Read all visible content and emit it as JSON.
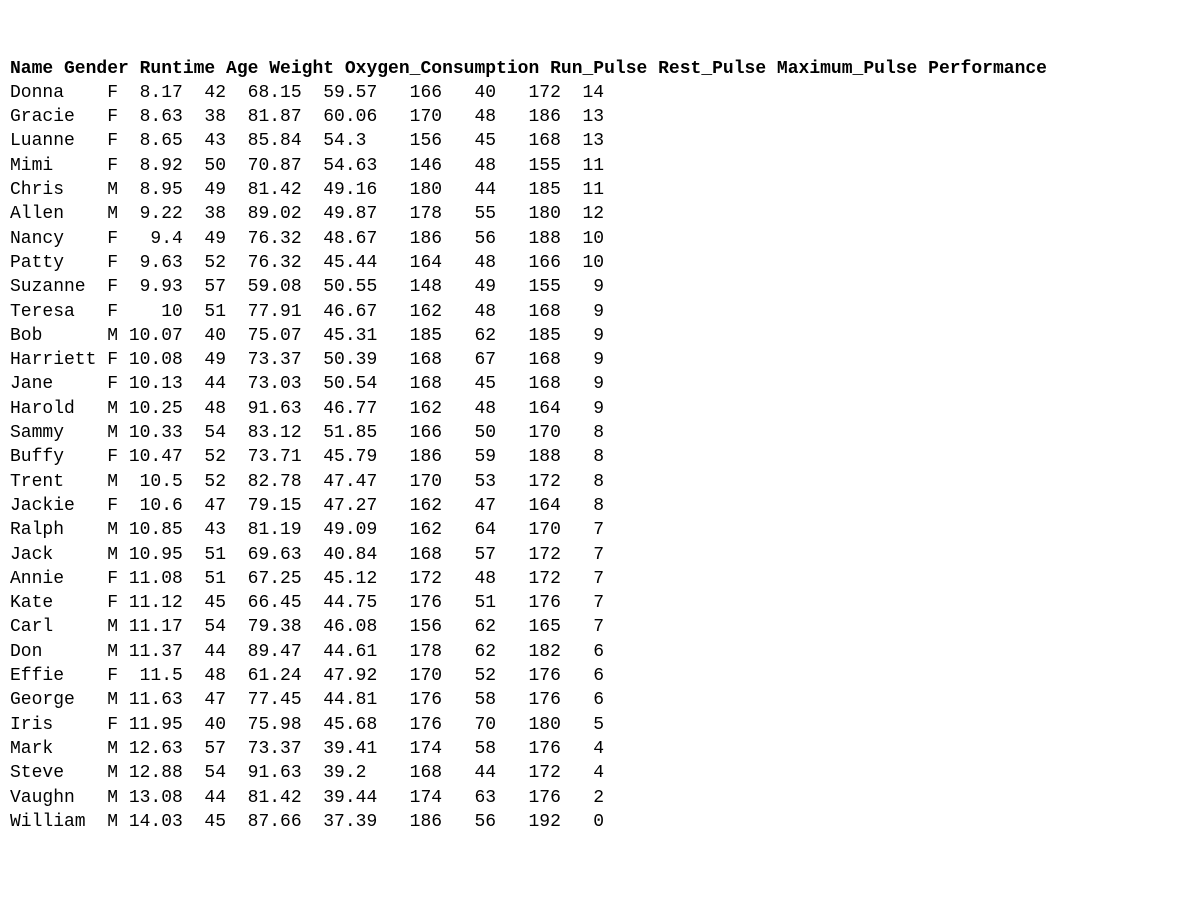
{
  "headers": [
    "Name",
    "Gender",
    "Runtime",
    "Age",
    "Weight",
    "Oxygen_Consumption",
    "Run_Pulse",
    "Rest_Pulse",
    "Maximum_Pulse",
    "Performance"
  ],
  "rows": [
    {
      "Name": "Donna",
      "Gender": "F",
      "Runtime": "8.17",
      "Age": "42",
      "Weight": "68.15",
      "Oxygen_Consumption": "59.57",
      "Run_Pulse": "166",
      "Rest_Pulse": "40",
      "Maximum_Pulse": "172",
      "Performance": "14"
    },
    {
      "Name": "Gracie",
      "Gender": "F",
      "Runtime": "8.63",
      "Age": "38",
      "Weight": "81.87",
      "Oxygen_Consumption": "60.06",
      "Run_Pulse": "170",
      "Rest_Pulse": "48",
      "Maximum_Pulse": "186",
      "Performance": "13"
    },
    {
      "Name": "Luanne",
      "Gender": "F",
      "Runtime": "8.65",
      "Age": "43",
      "Weight": "85.84",
      "Oxygen_Consumption": "54.3",
      "Run_Pulse": "156",
      "Rest_Pulse": "45",
      "Maximum_Pulse": "168",
      "Performance": "13"
    },
    {
      "Name": "Mimi",
      "Gender": "F",
      "Runtime": "8.92",
      "Age": "50",
      "Weight": "70.87",
      "Oxygen_Consumption": "54.63",
      "Run_Pulse": "146",
      "Rest_Pulse": "48",
      "Maximum_Pulse": "155",
      "Performance": "11"
    },
    {
      "Name": "Chris",
      "Gender": "M",
      "Runtime": "8.95",
      "Age": "49",
      "Weight": "81.42",
      "Oxygen_Consumption": "49.16",
      "Run_Pulse": "180",
      "Rest_Pulse": "44",
      "Maximum_Pulse": "185",
      "Performance": "11"
    },
    {
      "Name": "Allen",
      "Gender": "M",
      "Runtime": "9.22",
      "Age": "38",
      "Weight": "89.02",
      "Oxygen_Consumption": "49.87",
      "Run_Pulse": "178",
      "Rest_Pulse": "55",
      "Maximum_Pulse": "180",
      "Performance": "12"
    },
    {
      "Name": "Nancy",
      "Gender": "F",
      "Runtime": "9.4",
      "Age": "49",
      "Weight": "76.32",
      "Oxygen_Consumption": "48.67",
      "Run_Pulse": "186",
      "Rest_Pulse": "56",
      "Maximum_Pulse": "188",
      "Performance": "10"
    },
    {
      "Name": "Patty",
      "Gender": "F",
      "Runtime": "9.63",
      "Age": "52",
      "Weight": "76.32",
      "Oxygen_Consumption": "45.44",
      "Run_Pulse": "164",
      "Rest_Pulse": "48",
      "Maximum_Pulse": "166",
      "Performance": "10"
    },
    {
      "Name": "Suzanne",
      "Gender": "F",
      "Runtime": "9.93",
      "Age": "57",
      "Weight": "59.08",
      "Oxygen_Consumption": "50.55",
      "Run_Pulse": "148",
      "Rest_Pulse": "49",
      "Maximum_Pulse": "155",
      "Performance": "9"
    },
    {
      "Name": "Teresa",
      "Gender": "F",
      "Runtime": "10",
      "Age": "51",
      "Weight": "77.91",
      "Oxygen_Consumption": "46.67",
      "Run_Pulse": "162",
      "Rest_Pulse": "48",
      "Maximum_Pulse": "168",
      "Performance": "9"
    },
    {
      "Name": "Bob",
      "Gender": "M",
      "Runtime": "10.07",
      "Age": "40",
      "Weight": "75.07",
      "Oxygen_Consumption": "45.31",
      "Run_Pulse": "185",
      "Rest_Pulse": "62",
      "Maximum_Pulse": "185",
      "Performance": "9"
    },
    {
      "Name": "Harriett",
      "Gender": "F",
      "Runtime": "10.08",
      "Age": "49",
      "Weight": "73.37",
      "Oxygen_Consumption": "50.39",
      "Run_Pulse": "168",
      "Rest_Pulse": "67",
      "Maximum_Pulse": "168",
      "Performance": "9"
    },
    {
      "Name": "Jane",
      "Gender": "F",
      "Runtime": "10.13",
      "Age": "44",
      "Weight": "73.03",
      "Oxygen_Consumption": "50.54",
      "Run_Pulse": "168",
      "Rest_Pulse": "45",
      "Maximum_Pulse": "168",
      "Performance": "9"
    },
    {
      "Name": "Harold",
      "Gender": "M",
      "Runtime": "10.25",
      "Age": "48",
      "Weight": "91.63",
      "Oxygen_Consumption": "46.77",
      "Run_Pulse": "162",
      "Rest_Pulse": "48",
      "Maximum_Pulse": "164",
      "Performance": "9"
    },
    {
      "Name": "Sammy",
      "Gender": "M",
      "Runtime": "10.33",
      "Age": "54",
      "Weight": "83.12",
      "Oxygen_Consumption": "51.85",
      "Run_Pulse": "166",
      "Rest_Pulse": "50",
      "Maximum_Pulse": "170",
      "Performance": "8"
    },
    {
      "Name": "Buffy",
      "Gender": "F",
      "Runtime": "10.47",
      "Age": "52",
      "Weight": "73.71",
      "Oxygen_Consumption": "45.79",
      "Run_Pulse": "186",
      "Rest_Pulse": "59",
      "Maximum_Pulse": "188",
      "Performance": "8"
    },
    {
      "Name": "Trent",
      "Gender": "M",
      "Runtime": "10.5",
      "Age": "52",
      "Weight": "82.78",
      "Oxygen_Consumption": "47.47",
      "Run_Pulse": "170",
      "Rest_Pulse": "53",
      "Maximum_Pulse": "172",
      "Performance": "8"
    },
    {
      "Name": "Jackie",
      "Gender": "F",
      "Runtime": "10.6",
      "Age": "47",
      "Weight": "79.15",
      "Oxygen_Consumption": "47.27",
      "Run_Pulse": "162",
      "Rest_Pulse": "47",
      "Maximum_Pulse": "164",
      "Performance": "8"
    },
    {
      "Name": "Ralph",
      "Gender": "M",
      "Runtime": "10.85",
      "Age": "43",
      "Weight": "81.19",
      "Oxygen_Consumption": "49.09",
      "Run_Pulse": "162",
      "Rest_Pulse": "64",
      "Maximum_Pulse": "170",
      "Performance": "7"
    },
    {
      "Name": "Jack",
      "Gender": "M",
      "Runtime": "10.95",
      "Age": "51",
      "Weight": "69.63",
      "Oxygen_Consumption": "40.84",
      "Run_Pulse": "168",
      "Rest_Pulse": "57",
      "Maximum_Pulse": "172",
      "Performance": "7"
    },
    {
      "Name": "Annie",
      "Gender": "F",
      "Runtime": "11.08",
      "Age": "51",
      "Weight": "67.25",
      "Oxygen_Consumption": "45.12",
      "Run_Pulse": "172",
      "Rest_Pulse": "48",
      "Maximum_Pulse": "172",
      "Performance": "7"
    },
    {
      "Name": "Kate",
      "Gender": "F",
      "Runtime": "11.12",
      "Age": "45",
      "Weight": "66.45",
      "Oxygen_Consumption": "44.75",
      "Run_Pulse": "176",
      "Rest_Pulse": "51",
      "Maximum_Pulse": "176",
      "Performance": "7"
    },
    {
      "Name": "Carl",
      "Gender": "M",
      "Runtime": "11.17",
      "Age": "54",
      "Weight": "79.38",
      "Oxygen_Consumption": "46.08",
      "Run_Pulse": "156",
      "Rest_Pulse": "62",
      "Maximum_Pulse": "165",
      "Performance": "7"
    },
    {
      "Name": "Don",
      "Gender": "M",
      "Runtime": "11.37",
      "Age": "44",
      "Weight": "89.47",
      "Oxygen_Consumption": "44.61",
      "Run_Pulse": "178",
      "Rest_Pulse": "62",
      "Maximum_Pulse": "182",
      "Performance": "6"
    },
    {
      "Name": "Effie",
      "Gender": "F",
      "Runtime": "11.5",
      "Age": "48",
      "Weight": "61.24",
      "Oxygen_Consumption": "47.92",
      "Run_Pulse": "170",
      "Rest_Pulse": "52",
      "Maximum_Pulse": "176",
      "Performance": "6"
    },
    {
      "Name": "George",
      "Gender": "M",
      "Runtime": "11.63",
      "Age": "47",
      "Weight": "77.45",
      "Oxygen_Consumption": "44.81",
      "Run_Pulse": "176",
      "Rest_Pulse": "58",
      "Maximum_Pulse": "176",
      "Performance": "6"
    },
    {
      "Name": "Iris",
      "Gender": "F",
      "Runtime": "11.95",
      "Age": "40",
      "Weight": "75.98",
      "Oxygen_Consumption": "45.68",
      "Run_Pulse": "176",
      "Rest_Pulse": "70",
      "Maximum_Pulse": "180",
      "Performance": "5"
    },
    {
      "Name": "Mark",
      "Gender": "M",
      "Runtime": "12.63",
      "Age": "57",
      "Weight": "73.37",
      "Oxygen_Consumption": "39.41",
      "Run_Pulse": "174",
      "Rest_Pulse": "58",
      "Maximum_Pulse": "176",
      "Performance": "4"
    },
    {
      "Name": "Steve",
      "Gender": "M",
      "Runtime": "12.88",
      "Age": "54",
      "Weight": "91.63",
      "Oxygen_Consumption": "39.2",
      "Run_Pulse": "168",
      "Rest_Pulse": "44",
      "Maximum_Pulse": "172",
      "Performance": "4"
    },
    {
      "Name": "Vaughn",
      "Gender": "M",
      "Runtime": "13.08",
      "Age": "44",
      "Weight": "81.42",
      "Oxygen_Consumption": "39.44",
      "Run_Pulse": "174",
      "Rest_Pulse": "63",
      "Maximum_Pulse": "176",
      "Performance": "2"
    },
    {
      "Name": "William",
      "Gender": "M",
      "Runtime": "14.03",
      "Age": "45",
      "Weight": "87.66",
      "Oxygen_Consumption": "37.39",
      "Run_Pulse": "186",
      "Rest_Pulse": "56",
      "Maximum_Pulse": "192",
      "Performance": "0"
    }
  ],
  "chart_data": {
    "type": "table",
    "columns": [
      "Name",
      "Gender",
      "Runtime",
      "Age",
      "Weight",
      "Oxygen_Consumption",
      "Run_Pulse",
      "Rest_Pulse",
      "Maximum_Pulse",
      "Performance"
    ]
  }
}
